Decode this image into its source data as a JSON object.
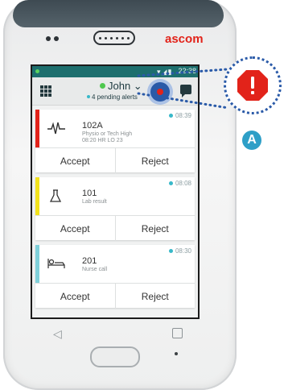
{
  "device": {
    "brand": "ascom"
  },
  "status_bar": {
    "time": "22:38"
  },
  "header": {
    "user_name": "John ⌄",
    "pending_alerts": "4 pending alerts"
  },
  "alerts": [
    {
      "room": "102A",
      "line1": "Physio or Tech High",
      "line2": "08:20 HR LO 23",
      "time": "08:39",
      "color": "#e2231a",
      "icon": "ecg-waveform-icon",
      "accept_label": "Accept",
      "reject_label": "Reject"
    },
    {
      "room": "101",
      "line1": "Lab result",
      "time": "08:08",
      "color": "#f2e21c",
      "icon": "lab-flask-icon",
      "accept_label": "Accept",
      "reject_label": "Reject"
    },
    {
      "room": "201",
      "line1": "Nurse call",
      "time": "08:30",
      "color": "#7fd0da",
      "icon": "patient-bed-icon",
      "accept_label": "Accept",
      "reject_label": "Reject"
    }
  ],
  "callout": {
    "label": "A",
    "accent_color": "#2a5aa8",
    "warning_color": "#e2231a"
  }
}
